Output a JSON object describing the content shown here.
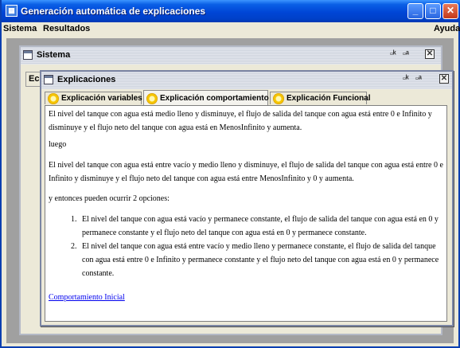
{
  "window": {
    "title": "Generación automática de explicaciones"
  },
  "menubar": {
    "items": [
      "Sistema",
      "Resultados"
    ],
    "help": "Ayuda"
  },
  "sistema_frame": {
    "title": "Sistema",
    "tab_label": "Ec"
  },
  "explicaciones_frame": {
    "title": "Explicaciones",
    "tabs": [
      {
        "label": "Explicación variables",
        "active": false
      },
      {
        "label": "Explicación comportamiento",
        "active": true
      },
      {
        "label": "Explicación Funcional",
        "active": false
      }
    ]
  },
  "content": {
    "paragraph_1": "El nivel del tanque con agua está medio lleno y disminuye, el flujo de salida del tanque con agua está entre 0 e Infinito y disminuye y el flujo neto del tanque con agua está en MenosInfinito y aumenta.",
    "paragraph_2": "luego",
    "paragraph_3": "El nivel del tanque con agua está entre vacío y medio lleno y disminuye, el flujo de salida del tanque con agua está entre 0 e Infinito y disminuye y el flujo neto del tanque con agua está entre MenosInfinito y 0 y aumenta.",
    "paragraph_4": "y entonces pueden ocurrir 2 opciones:",
    "options": [
      {
        "num": "1.",
        "text": "El nivel del tanque con agua está vacío y permanece constante, el flujo de salida del tanque con agua está en 0 y permanece constante y el flujo neto del tanque con agua está en 0 y permanece constante."
      },
      {
        "num": "2.",
        "text": "El nivel del tanque con agua está entre vacío y medio lleno y permanece constante, el flujo de salida del tanque con agua está entre 0 e Infinito y permanece constante y el flujo neto del tanque con agua está en 0 y permanece constante."
      }
    ],
    "link": "Comportamiento Inicial"
  }
}
